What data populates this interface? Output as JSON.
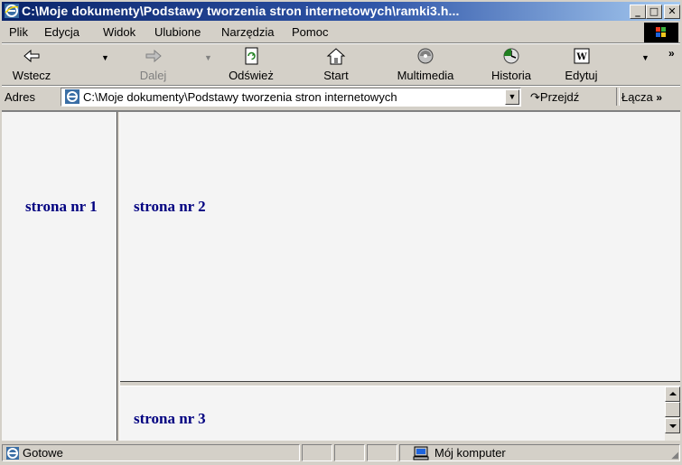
{
  "window": {
    "title": "C:\\Moje dokumenty\\Podstawy tworzenia stron internetowych\\ramki3.h...",
    "minimize": "_",
    "maximize": "□",
    "close": "✕"
  },
  "menu": [
    {
      "label": "Plik"
    },
    {
      "label": "Edycja"
    },
    {
      "label": "Widok"
    },
    {
      "label": "Ulubione"
    },
    {
      "label": "Narzędzia"
    },
    {
      "label": "Pomoc"
    }
  ],
  "toolbar": {
    "back": "Wstecz",
    "forward": "Dalej",
    "refresh": "Odśwież",
    "home": "Start",
    "media": "Multimedia",
    "history": "Historia",
    "edit": "Edytuj"
  },
  "address": {
    "label": "Adres",
    "value": "C:\\Moje dokumenty\\Podstawy tworzenia stron internetowych",
    "go": "Przejdź",
    "links": "Łącza"
  },
  "frames": {
    "frame1_text": "strona nr 1",
    "frame2_text": "strona nr 2",
    "frame3_text": "strona nr 3"
  },
  "status": {
    "text": "Gotowe",
    "zone": "Mój komputer"
  },
  "colors": {
    "frame_text": "#000080",
    "titlebar": "#0a246a"
  }
}
